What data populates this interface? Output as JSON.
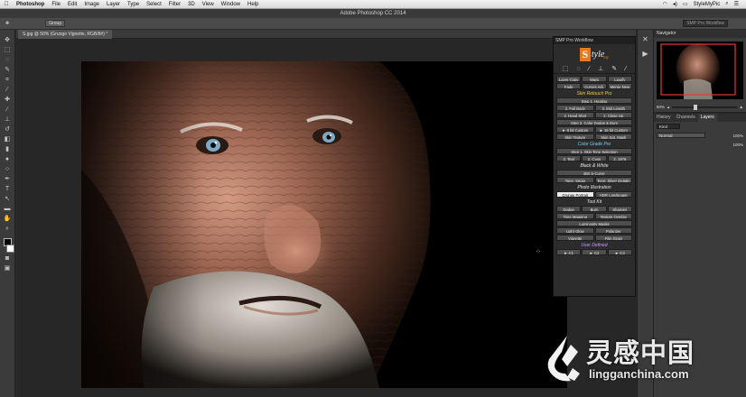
{
  "menubar": {
    "apple": "",
    "items": [
      "Photoshop",
      "File",
      "Edit",
      "Image",
      "Layer",
      "Type",
      "Select",
      "Filter",
      "3D",
      "View",
      "Window",
      "Help"
    ],
    "user": "StyleMyPic"
  },
  "window": {
    "title": "Adobe Photoshop CC 2014"
  },
  "options": {
    "group_label": "Group",
    "workflow_label": "SMP Pro Workflow"
  },
  "document": {
    "tab_label": "S.jpg @ 50% (Grunge Vignette, RGB/8#) *"
  },
  "smp": {
    "title": "SMP Pro Workflow",
    "logo_s": "S",
    "logo_rest": "tyle",
    "logo_sub": "my",
    "sections": {
      "skin": "Skin Retouch Pro",
      "color": "Color Grade Pro",
      "bw": "Black & White",
      "photo": "Photo Illustration",
      "tool": "Tool Kit",
      "user": "User Defined"
    },
    "buttons": {
      "layer_copy": "Layer Copy",
      "warp": "Warp",
      "liquify": "Liquify",
      "fade": "Fade",
      "curves_adj": "Curves Adj.",
      "merge_new": "Merge New",
      "step1_healing": "Step 1. Healing",
      "full_body": "2. Full Body",
      "mid_length": "2. Mid Length",
      "head_shot": "2. Head Shot",
      "close_up": "2. Close Up",
      "step3": "Step 3. Color Dodge & Burn",
      "custom8": "► 8 bit Custom",
      "custom16": "► 16 bit Custom",
      "skin_texture": "Skin Texture",
      "skin_sat_mask": "Skin Sat. Mask",
      "step1_skin": "Step 1. Skin Tone Selection",
      "teal": "2. Teal",
      "cyan": "2. Cyan",
      "y1976": "2. 1976",
      "bw_curve": "BW S-Curve",
      "tone_sepia": "Tone: Sepia",
      "tone_silver": "Tone: Silver Gelatin",
      "grunge_portrait": "Grunge Portrait",
      "hdr_landscape": "HDR Landscape",
      "dodge": "Dodge",
      "burn": "Burn",
      "sharpen": "Sharpen",
      "tone_mapping": "Tone Mapping",
      "texture_overlay": "Texture Overlay",
      "luminosity_masks": "Luminosity Masks",
      "light_glow": "Light Glow",
      "polarizer": "Polarizer",
      "vignette": "Vignette",
      "film_grain": "Film Grain",
      "c1": "► C1",
      "c2": "► C2",
      "c3": "► C3"
    }
  },
  "navigator": {
    "tab": "Navigator",
    "zoom": "50%"
  },
  "layers": {
    "tabs": [
      "History",
      "Channels",
      "Layers"
    ],
    "kind": "Kind",
    "blend": "Normal",
    "opacity": "100%",
    "fill": "100%"
  },
  "watermark": {
    "brand_cn": "灵感中国",
    "url": "lingganchina.com"
  },
  "colors": {
    "accent_orange": "#e8781e",
    "skin_title": "#f2c94a",
    "color_title": "#6fd6f0",
    "bw_title": "#e6e6e6",
    "photo_title": "#e6e6e6",
    "tool_title": "#e6e6e6",
    "user_title": "#c79bff"
  }
}
